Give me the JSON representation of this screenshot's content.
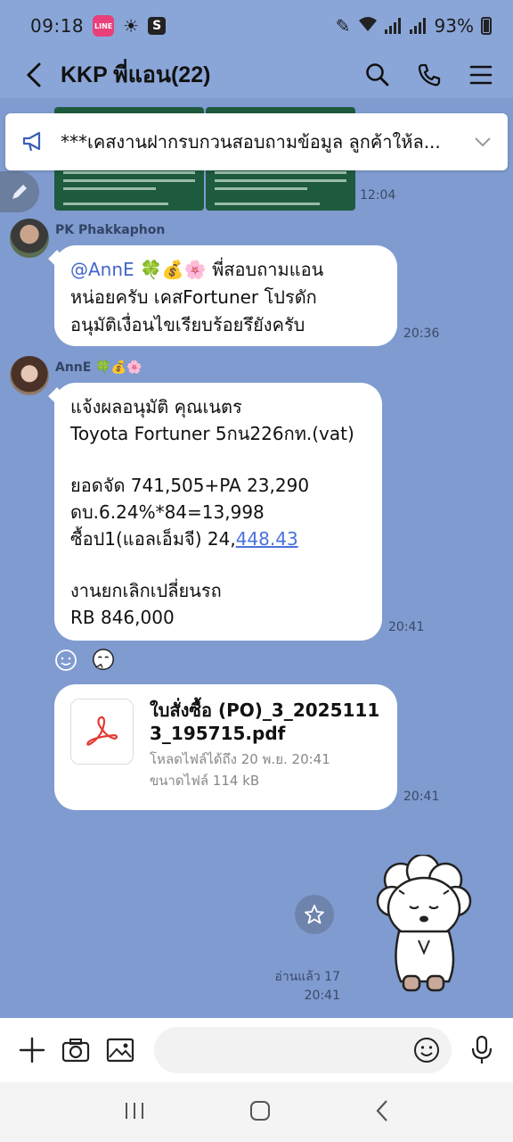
{
  "status_bar": {
    "time": "09:18",
    "battery": "93%"
  },
  "header": {
    "title": "KKP พี่แอน(22)"
  },
  "announcement": {
    "text": "***เคสงานฝากรบกวนสอบถามข้อมูล ลูกค้าให้ล..."
  },
  "messages": {
    "image_time": "12:04",
    "m1": {
      "sender": "PK Phakkaphon",
      "mention": "@AnnE 🍀💰🌸",
      "line1_rest": " พี่สอบถามแอน",
      "line2": "หน่อยครับ เคสFortuner โปรดัก",
      "line3": "อนุมัติเงื่อนไขเรียบร้อยรึยังครับ",
      "time": "20:36"
    },
    "m2": {
      "sender": "AnnE 🍀💰🌸",
      "l1": "แจ้งผลอนุมัติ คุณเนตร",
      "l2": "Toyota Fortuner 5กน226กท.(vat)",
      "l3": "ยอดจัด 741,505+PA 23,290",
      "l4": "ดบ.6.24%*84=13,998",
      "l5_pre": "ซื้อป1(แอลเอ็มจี) 24,",
      "l5_link": "448.43",
      "l6": "งานยกเลิกเปลี่ยนรถ",
      "l7": "RB 846,000",
      "time": "20:41"
    },
    "file": {
      "name": "ใบสั่งซื้อ (PO)_3_20251113_195715.pdf",
      "expiry": "โหลดไฟล์ได้ถึง 20 พ.ย. 20:41",
      "size": "ขนาดไฟล์ 114 kB",
      "time": "20:41"
    },
    "sticker_read": "อ่านแล้ว 17",
    "sticker_time": "20:41"
  },
  "input": {
    "placeholder": ""
  },
  "colors": {
    "background": "#7f9bd0",
    "link": "#4a72d9",
    "pdf_red": "#e53935"
  }
}
